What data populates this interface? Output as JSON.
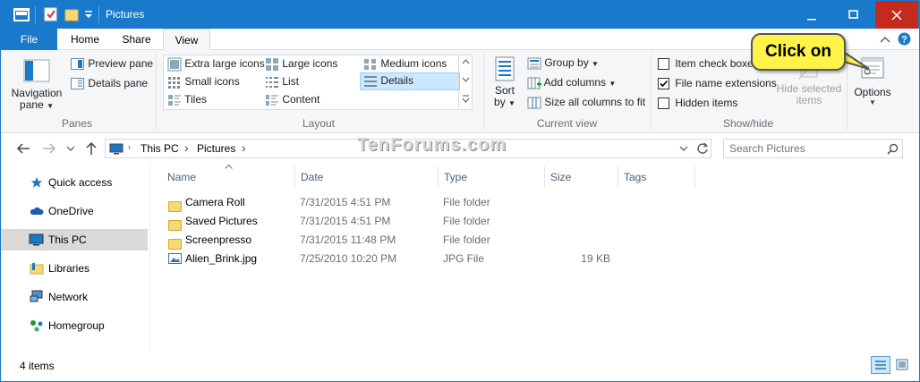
{
  "window": {
    "title": "Pictures"
  },
  "tabs": [
    "File",
    "Home",
    "Share",
    "View"
  ],
  "ribbon": {
    "panes": {
      "navigation_pane": "Navigation\npane",
      "nav_line1": "Navigation",
      "nav_line2": "pane",
      "preview_pane": "Preview pane",
      "details_pane": "Details pane",
      "label": "Panes"
    },
    "layout": {
      "items": [
        "Extra large icons",
        "Large icons",
        "Medium icons",
        "Small icons",
        "List",
        "Details",
        "Tiles",
        "Content"
      ],
      "label": "Layout",
      "selected": "Details"
    },
    "current_view": {
      "sort_line1": "Sort",
      "sort_line2": "by",
      "group_by": "Group by",
      "add_columns": "Add columns",
      "size_all": "Size all columns to fit",
      "label": "Current view"
    },
    "show_hide": {
      "item_check_boxes": "Item check boxes",
      "file_name_extensions": "File name extensions",
      "hidden_items": "Hidden items",
      "hide_line1": "Hide selected",
      "hide_line2": "items",
      "label": "Show/hide",
      "checked": {
        "item_check_boxes": false,
        "file_name_extensions": true,
        "hidden_items": false
      }
    },
    "options": "Options"
  },
  "callout": "Click on",
  "watermark": "TenForums.com",
  "breadcrumb": [
    "This PC",
    "Pictures"
  ],
  "search": {
    "placeholder": "Search Pictures"
  },
  "nav_pane": [
    "Quick access",
    "OneDrive",
    "This PC",
    "Libraries",
    "Network",
    "Homegroup"
  ],
  "nav_selected": "This PC",
  "columns": [
    "Name",
    "Date",
    "Type",
    "Size",
    "Tags"
  ],
  "files": [
    {
      "name": "Camera Roll",
      "date": "7/31/2015 4:51 PM",
      "type": "File folder",
      "size": ""
    },
    {
      "name": "Saved Pictures",
      "date": "7/31/2015 4:51 PM",
      "type": "File folder",
      "size": ""
    },
    {
      "name": "Screenpresso",
      "date": "7/31/2015 11:48 PM",
      "type": "File folder",
      "size": ""
    },
    {
      "name": "Alien_Brink.jpg",
      "date": "7/25/2010 10:20 PM",
      "type": "JPG File",
      "size": "19 KB"
    }
  ],
  "status": {
    "count": "4 items"
  },
  "colors": {
    "accent": "#1979ca",
    "callout": "#fff34a",
    "close": "#c42b1c"
  }
}
